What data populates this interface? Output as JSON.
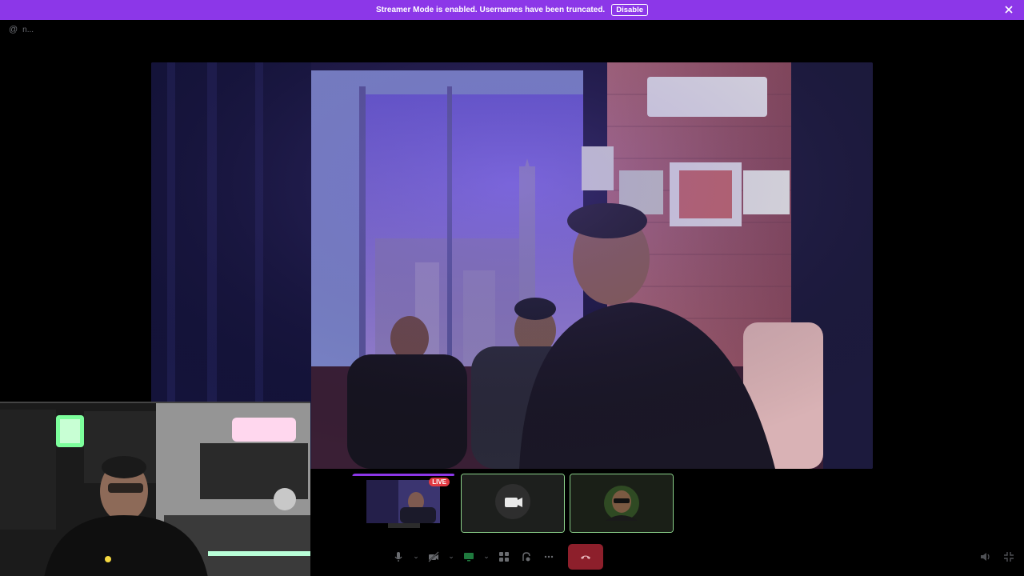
{
  "banner": {
    "text": "Streamer Mode is enabled. Usernames have been truncated.",
    "button_label": "Disable",
    "bg_color": "#8c37e8"
  },
  "channel": {
    "icon": "at-icon",
    "name": "n..."
  },
  "thumbnails": [
    {
      "kind": "stream-preview",
      "badge": "LIVE"
    },
    {
      "kind": "avatar",
      "icon": "camera-icon"
    },
    {
      "kind": "avatar",
      "icon": "user-avatar"
    }
  ],
  "controls": {
    "items": [
      "microphone-icon",
      "camera-off-icon",
      "screen-share-icon",
      "activities-icon",
      "soundboard-icon",
      "more-icon",
      "hangup-icon"
    ],
    "hangup_color": "#8d1f2b"
  },
  "corner": [
    "volume-icon",
    "fullscreen-exit-icon"
  ]
}
